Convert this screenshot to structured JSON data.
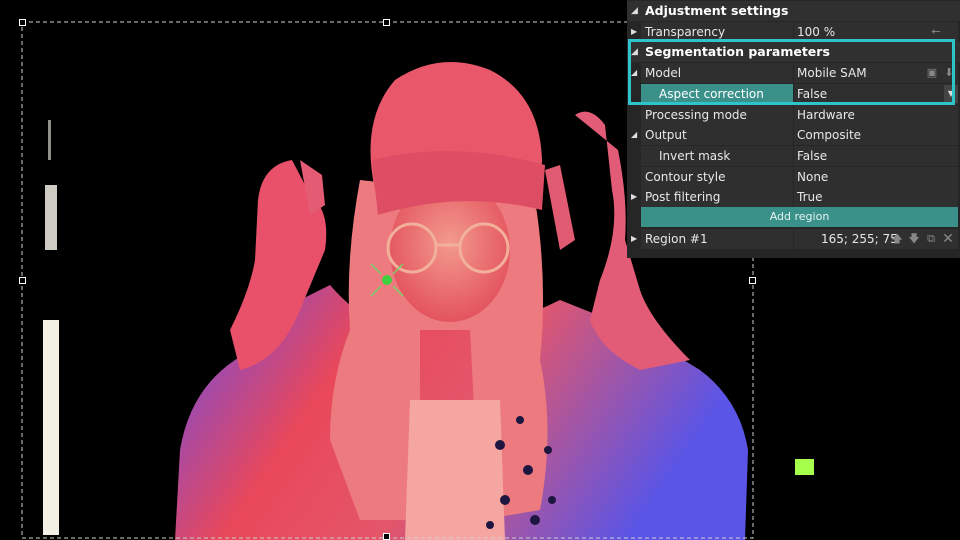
{
  "panel": {
    "adjustment_header": "Adjustment settings",
    "transparency": {
      "label": "Transparency",
      "value": "100 %"
    },
    "segmentation_header": "Segmentation parameters",
    "model": {
      "label": "Model",
      "value": "Mobile SAM"
    },
    "aspect_correction": {
      "label": "Aspect correction",
      "value": "False"
    },
    "processing_mode": {
      "label": "Processing mode",
      "value": "Hardware"
    },
    "output": {
      "label": "Output",
      "value": "Composite"
    },
    "invert_mask": {
      "label": "Invert mask",
      "value": "False"
    },
    "contour_style": {
      "label": "Contour style",
      "value": "None"
    },
    "post_filtering": {
      "label": "Post filtering",
      "value": "True"
    },
    "add_region_label": "Add region",
    "region": {
      "label": "Region #1",
      "color_value": "165; 255; 75",
      "swatch_color": "#a5ff4b"
    }
  },
  "colors": {
    "accent": "#3a918a",
    "highlight_border": "#2ec4cb",
    "panel_bg": "#262626"
  },
  "icons": [
    "folder-icon",
    "download-icon",
    "arrow-up-icon",
    "arrow-down-icon",
    "copy-icon",
    "close-icon",
    "expand-arrow-icon",
    "collapse-arrow-icon",
    "dropdown-arrow-icon",
    "target-point-icon"
  ]
}
